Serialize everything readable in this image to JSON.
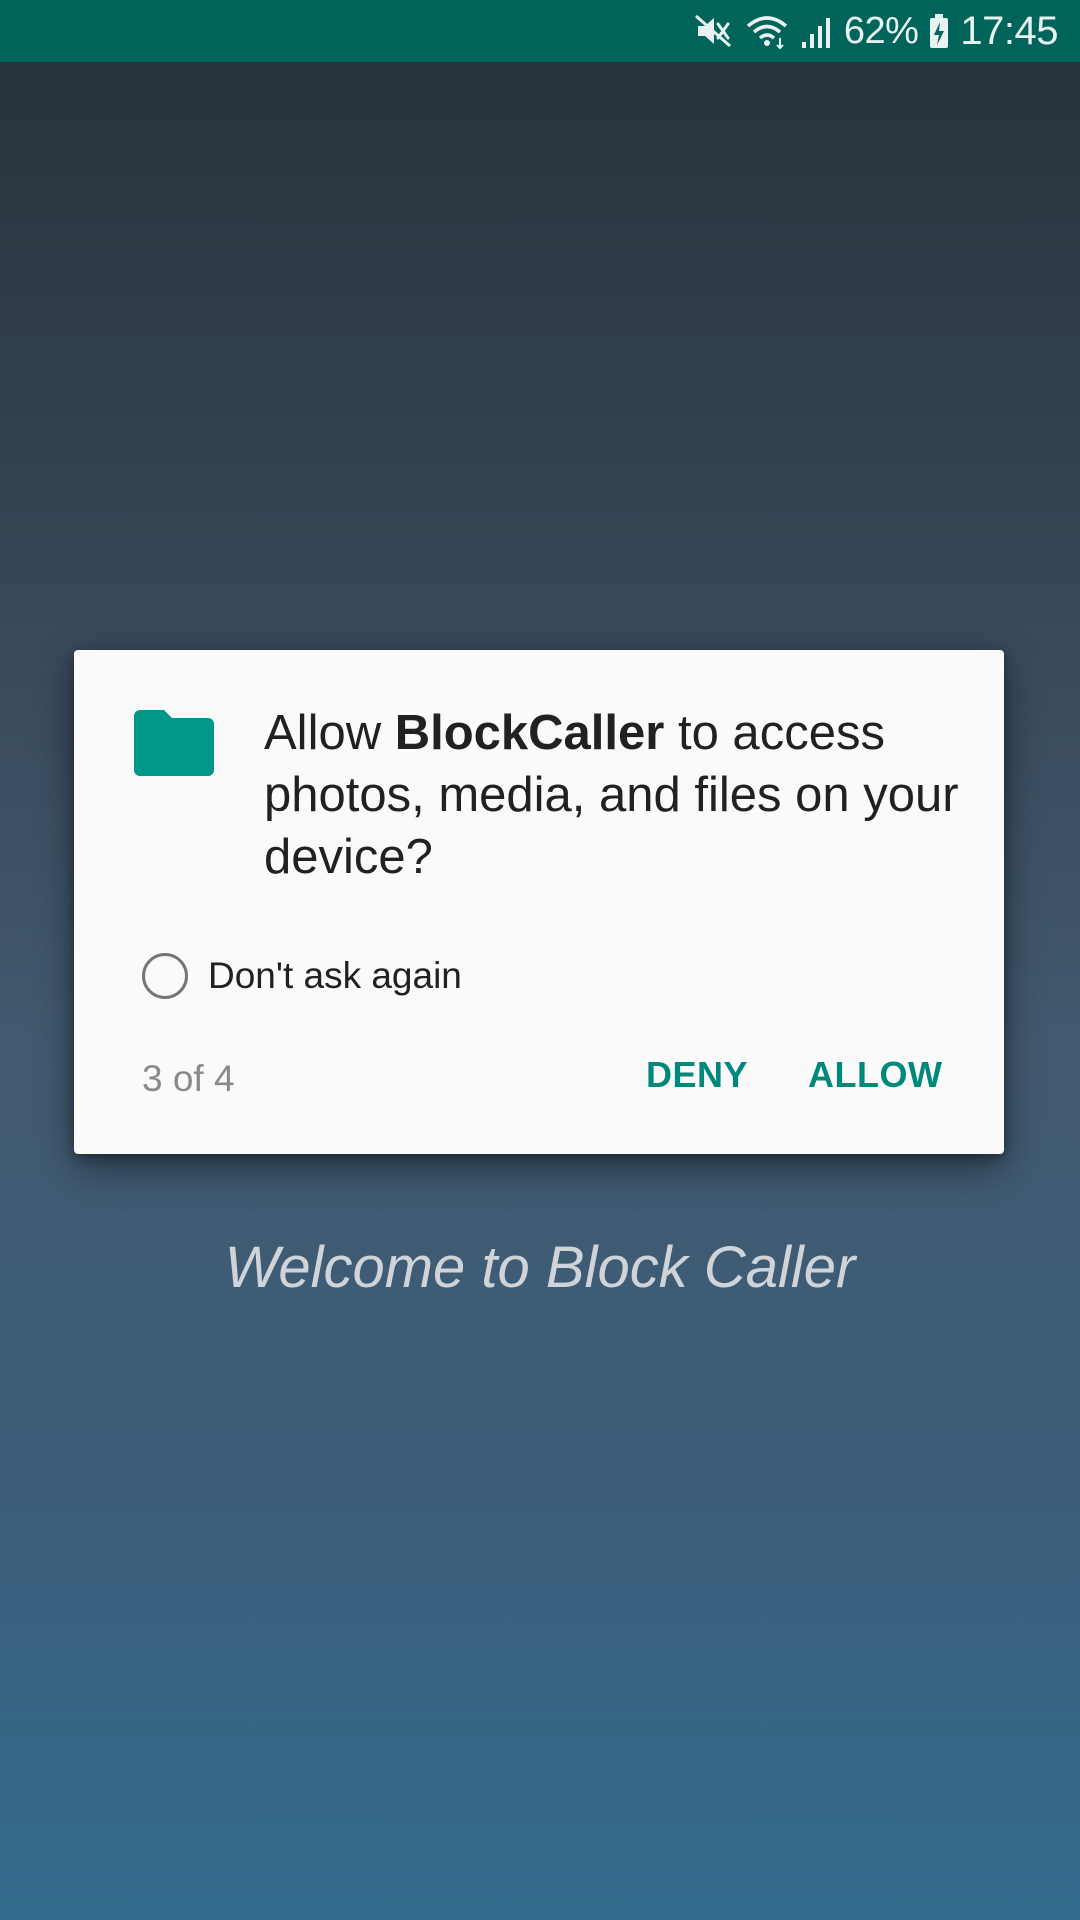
{
  "status_bar": {
    "icons": [
      "mute-icon",
      "wifi-icon",
      "signal-icon",
      "battery-charging-icon"
    ],
    "battery": "62%",
    "time": "17:45",
    "color": "#00645a"
  },
  "dialog": {
    "icon": "folder-icon",
    "message_prefix": "Allow ",
    "app_name": "BlockCaller",
    "message_suffix": " to access photos, media, and files on your device?",
    "dont_ask_label": "Don't ask again",
    "dont_ask_checked": false,
    "counter": "3 of 4",
    "deny_label": "DENY",
    "allow_label": "ALLOW",
    "accent_color": "#00897b"
  },
  "background": {
    "welcome_text": "Welcome to Block Caller"
  }
}
